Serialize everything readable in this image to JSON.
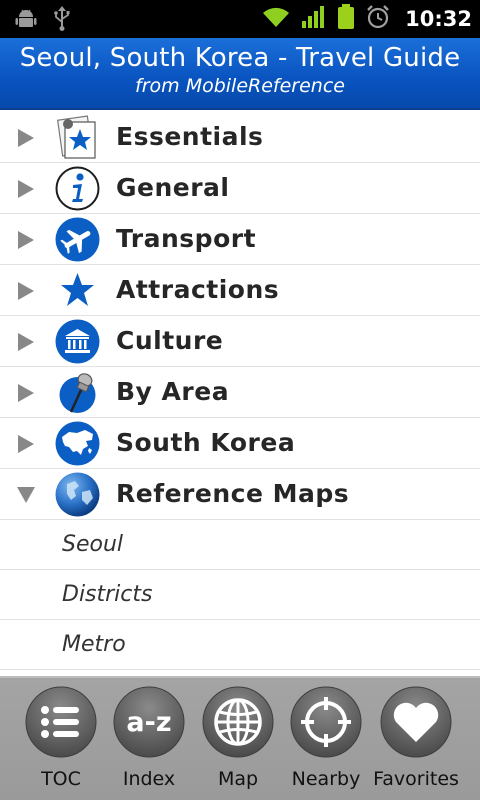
{
  "status_bar": {
    "time": "10:32"
  },
  "header": {
    "title": "Seoul, South Korea - Travel Guide",
    "subtitle": "from MobileReference"
  },
  "menu": [
    {
      "label": "Essentials",
      "icon": "star-document-icon",
      "expanded": false
    },
    {
      "label": "General",
      "icon": "info-icon",
      "expanded": false
    },
    {
      "label": "Transport",
      "icon": "airplane-icon",
      "expanded": false
    },
    {
      "label": "Attractions",
      "icon": "star-icon",
      "expanded": false
    },
    {
      "label": "Culture",
      "icon": "museum-icon",
      "expanded": false
    },
    {
      "label": "By Area",
      "icon": "pushpin-icon",
      "expanded": false
    },
    {
      "label": "South Korea",
      "icon": "continent-map-icon",
      "expanded": false
    },
    {
      "label": "Reference Maps",
      "icon": "globe-icon",
      "expanded": true
    }
  ],
  "submenu": [
    {
      "label": "Seoul"
    },
    {
      "label": "Districts"
    },
    {
      "label": "Metro"
    }
  ],
  "toolbar": [
    {
      "label": "TOC",
      "icon": "list-icon"
    },
    {
      "label": "Index",
      "icon": "a-z-icon",
      "glyph": "a-z"
    },
    {
      "label": "Map",
      "icon": "globe-wire-icon"
    },
    {
      "label": "Nearby",
      "icon": "crosshair-icon"
    },
    {
      "label": "Favorites",
      "icon": "heart-icon"
    }
  ],
  "colors": {
    "header_blue": "#0a55c2",
    "icon_blue": "#0b5fc4",
    "toolbar_gray": "#9f9f9f",
    "battery_green": "#9bd01c",
    "wifi_green": "#8fcf1f"
  }
}
